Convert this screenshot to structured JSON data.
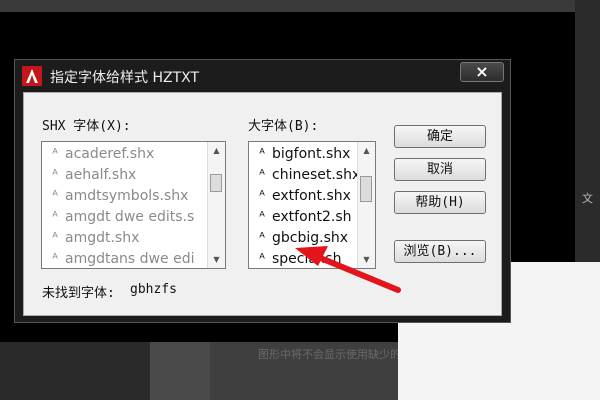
{
  "background": {
    "side_text": "文",
    "blur_text": "图形中将不会显示使用缺少的"
  },
  "dialog": {
    "title": "指定字体给样式 HZTXT",
    "close_glyph": "×",
    "shx_label": "SHX 字体(X):",
    "big_label": "大字体(B):",
    "shx_fonts": [
      "acaderef.shx",
      "aehalf.shx",
      "amdtsymbols.shx",
      "amgdt dwe edits.s",
      "amgdt.shx",
      "amgdtans dwe edi"
    ],
    "big_fonts": [
      "bigfont.shx",
      "chineset.shx",
      "extfont.shx",
      "extfont2.sh",
      "gbcbig.shx",
      "special.sh"
    ],
    "buttons": {
      "ok": "确定",
      "cancel": "取消",
      "help": "帮助(H)",
      "browse": "浏览(B)..."
    },
    "not_found_label": "未找到字体:",
    "not_found_value": "gbhzfs",
    "font_icon": "font-file-icon"
  },
  "colors": {
    "arrow": "#e3141b",
    "dialog_frame": "#1c1c1c",
    "client": "#f0f0f0"
  }
}
